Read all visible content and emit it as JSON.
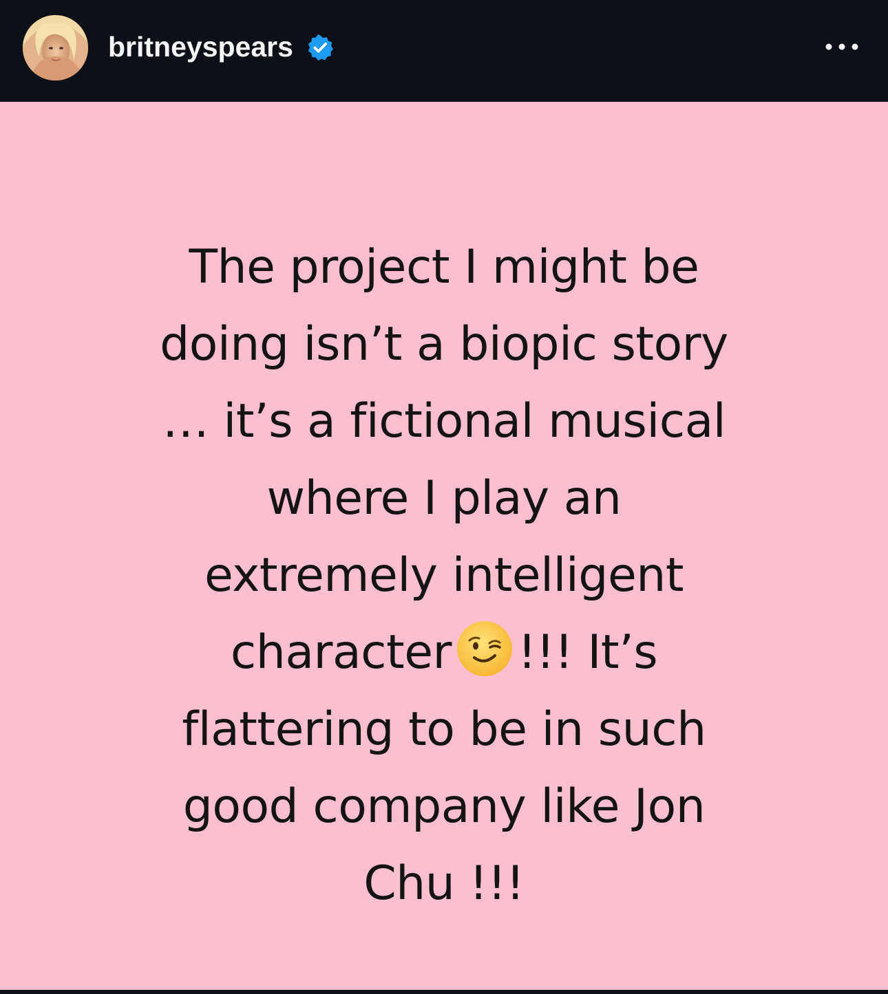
{
  "header": {
    "username": "britneyspears",
    "verified": true,
    "verified_icon": "verified-badge-icon",
    "more_icon": "more-options-icon",
    "avatar_icon": "profile-avatar"
  },
  "post": {
    "background_color": "#fcbfcf",
    "lines": [
      "The project I might be",
      "doing isn’t a biopic story",
      "… it’s a fictional musical",
      "where I play an",
      "extremely intelligent"
    ],
    "line6_before_emoji": "character",
    "emoji": "winking-face-emoji",
    "line6_after_emoji": "!!! It’s",
    "lines_end": [
      "flattering to be in such",
      "good company like Jon",
      "Chu !!!"
    ]
  },
  "colors": {
    "header_bg": "#0d1016",
    "text": "#141414",
    "verified_blue": "#0095f6"
  }
}
